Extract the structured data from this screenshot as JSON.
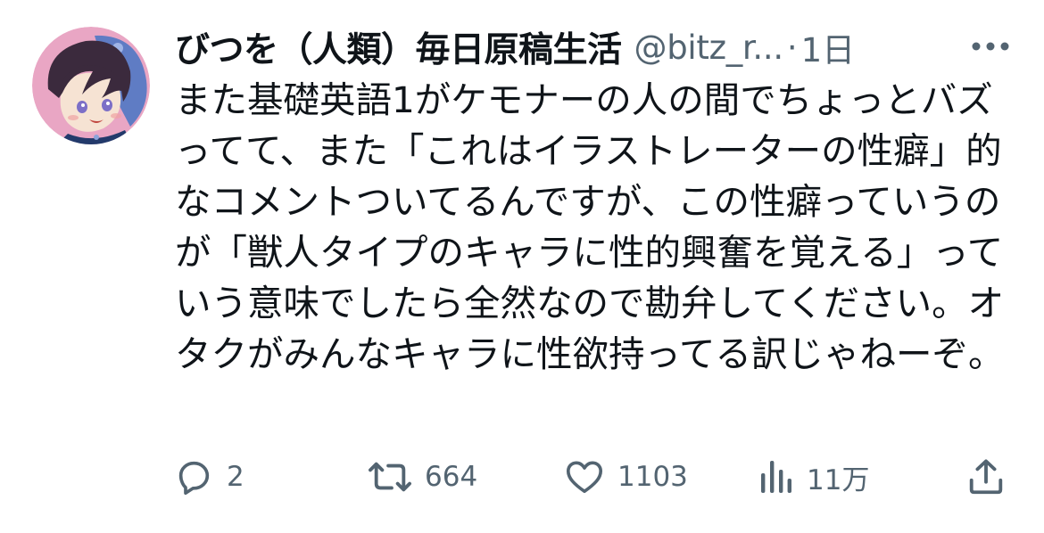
{
  "tweet": {
    "display_name": "びつを（人類）毎日原稿生活",
    "handle": "@bitz_r...",
    "separator": "·",
    "time": "1日",
    "text": "また基礎英語1がケモナーの人の間でちょっとバズってて、また「これはイラストレーターの性癖」的なコメントついてるんですが、この性癖っていうのが「獣人タイプのキャラに性的興奮を覚える」っていう意味でしたら全然なので勘弁してください。オタクがみんなキャラに性欲持ってる訳じゃねーぞ。",
    "avatar_icon": "user-avatar-illustration"
  },
  "actions": {
    "reply": {
      "icon": "reply-icon",
      "count": "2"
    },
    "retweet": {
      "icon": "retweet-icon",
      "count": "664"
    },
    "like": {
      "icon": "heart-icon",
      "count": "1103"
    },
    "views": {
      "icon": "views-icon",
      "count": "11万"
    },
    "share": {
      "icon": "share-icon"
    }
  },
  "colors": {
    "text_primary": "#0f1419",
    "text_secondary": "#536471",
    "background": "#ffffff"
  }
}
